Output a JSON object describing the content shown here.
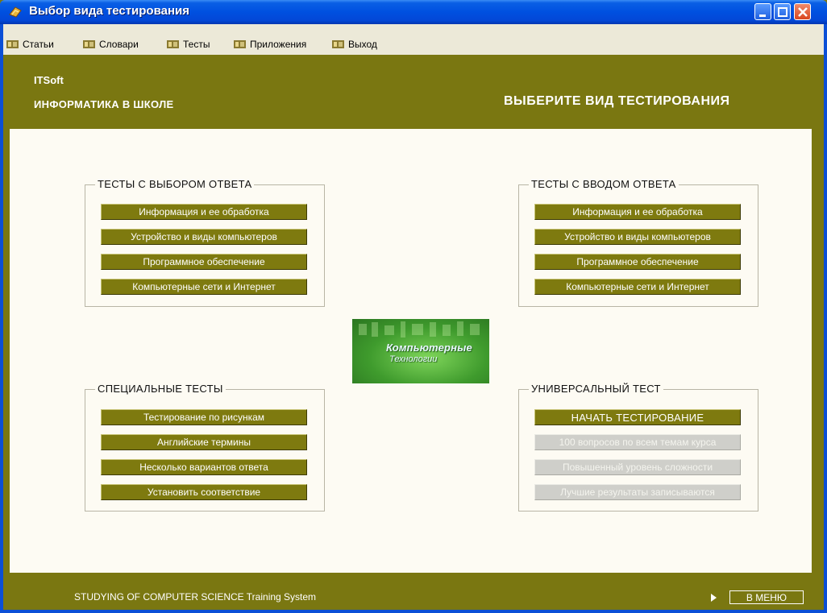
{
  "window": {
    "title": "Выбор вида тестирования"
  },
  "menu": {
    "items": [
      {
        "label": "Статьи",
        "icon": "menu-book-icon"
      },
      {
        "label": "Словари",
        "icon": "menu-book-icon"
      },
      {
        "label": "Тесты",
        "icon": "menu-book-icon"
      },
      {
        "label": "Приложения",
        "icon": "menu-book-icon"
      },
      {
        "label": "Выход",
        "icon": "menu-book-icon"
      }
    ]
  },
  "header": {
    "brand": "ITSoft",
    "subject": "ИНФОРМАТИКА В ШКОЛЕ",
    "headline": "ВЫБЕРИТЕ ВИД ТЕСТИРОВАНИЯ"
  },
  "groups": {
    "choice": {
      "title": "ТЕСТЫ С ВЫБОРОМ ОТВЕТА",
      "buttons": [
        "Информация и ее обработка",
        "Устройство и виды компьютеров",
        "Программное обеспечение",
        "Компьютерные сети и Интернет"
      ]
    },
    "input": {
      "title": "ТЕСТЫ С ВВОДОМ ОТВЕТА",
      "buttons": [
        "Информация и ее обработка",
        "Устройство и виды компьютеров",
        "Программное обеспечение",
        "Компьютерные сети и Интернет"
      ]
    },
    "special": {
      "title": "СПЕЦИАЛЬНЫЕ ТЕСТЫ",
      "buttons": [
        "Тестирование по рисункам",
        "Английские термины",
        "Несколько вариантов ответа",
        "Установить соответствие"
      ]
    },
    "universal": {
      "title": "УНИВЕРСАЛЬНЫЙ ТЕСТ",
      "start": "НАЧАТЬ ТЕСТИРОВАНИЕ",
      "info": [
        "100 вопросов по всем темам курса",
        "Повышенный уровень сложности",
        "Лучшие результаты записываются"
      ]
    }
  },
  "logo": {
    "line1": "Компьютерные",
    "line2": "Технологии"
  },
  "footer": {
    "text": "STUDYING OF COMPUTER SCIENCE Training System",
    "menu_button": "В МЕНЮ"
  },
  "colors": {
    "olive": "#7a7711",
    "panel": "#fdfbf3",
    "button": "#7e7a0f",
    "disabled": "#cfcfca"
  }
}
